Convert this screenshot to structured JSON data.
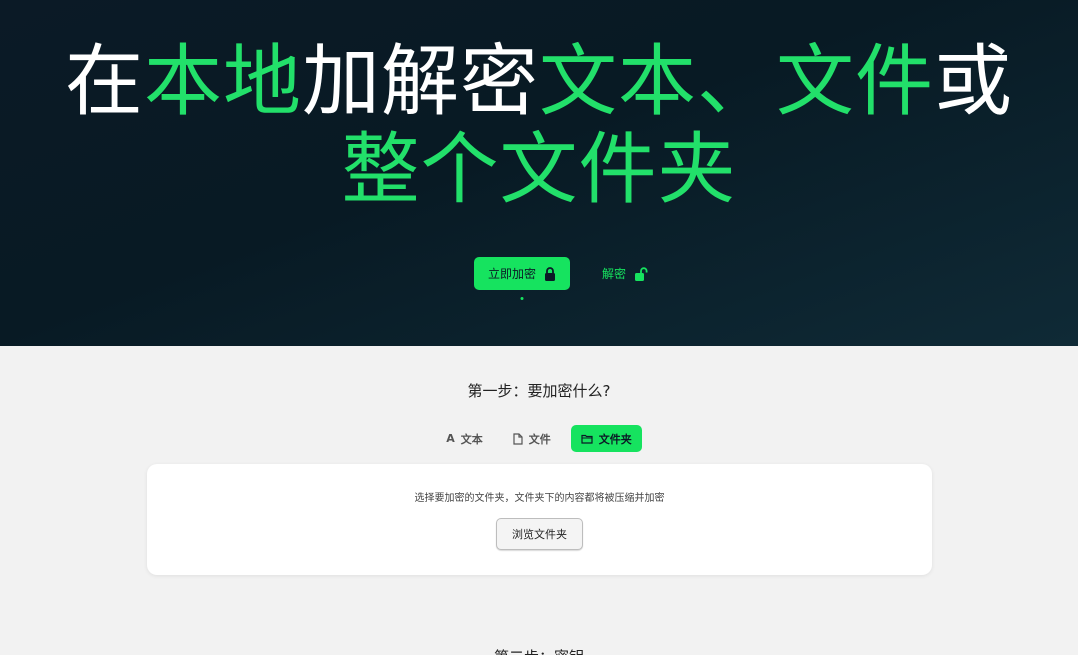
{
  "hero": {
    "title_parts": [
      "在",
      "本地",
      "加解密",
      "文本、",
      "文件",
      "或"
    ],
    "title_line2": "整个文件夹",
    "encrypt_label": "立即加密",
    "decrypt_label": "解密"
  },
  "step1": {
    "title": "第一步：要加密什么?",
    "tabs": [
      {
        "label": "文本",
        "icon": "text-icon"
      },
      {
        "label": "文件",
        "icon": "file-icon"
      },
      {
        "label": "文件夹",
        "icon": "folder-icon"
      }
    ],
    "active_tab": "文件夹",
    "description": "选择要加密的文件夹，文件夹下的内容都将被压缩并加密",
    "browse_label": "浏览文件夹"
  },
  "next_step_title": "第二步：密钥"
}
